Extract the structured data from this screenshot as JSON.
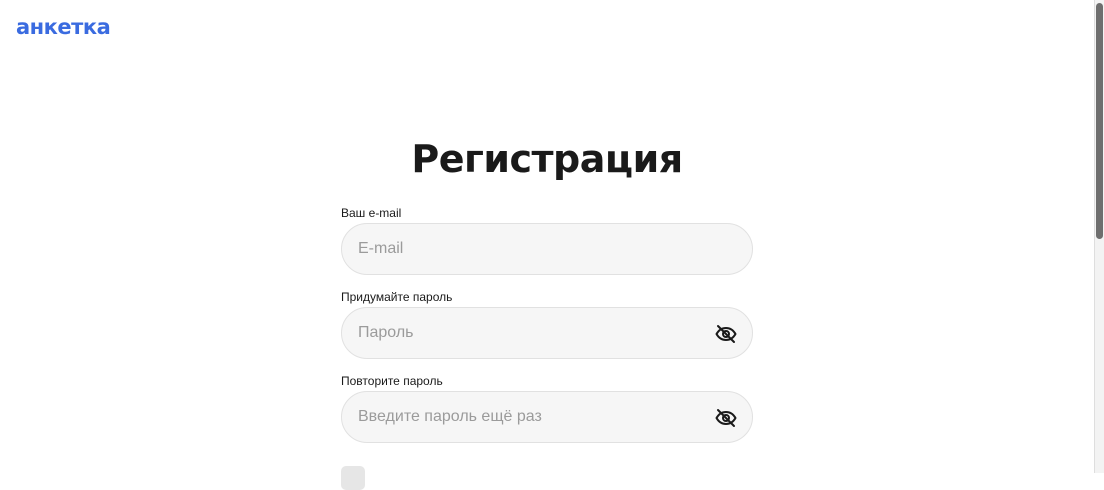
{
  "header": {
    "logo_text": "анкетка"
  },
  "page": {
    "title": "Регистрация"
  },
  "form": {
    "email": {
      "label": "Ваш e-mail",
      "placeholder": "E-mail",
      "value": ""
    },
    "password": {
      "label": "Придумайте пароль",
      "placeholder": "Пароль",
      "value": "",
      "toggle_icon": "eye-off-icon"
    },
    "password_confirm": {
      "label": "Повторите пароль",
      "placeholder": "Введите пароль ещё раз",
      "value": "",
      "toggle_icon": "eye-off-icon"
    }
  },
  "colors": {
    "brand": "#3a6be0",
    "input_background": "#f6f6f6",
    "input_border": "#e1e1e1",
    "placeholder": "#9b9b9b",
    "text": "#1a1a1a"
  }
}
